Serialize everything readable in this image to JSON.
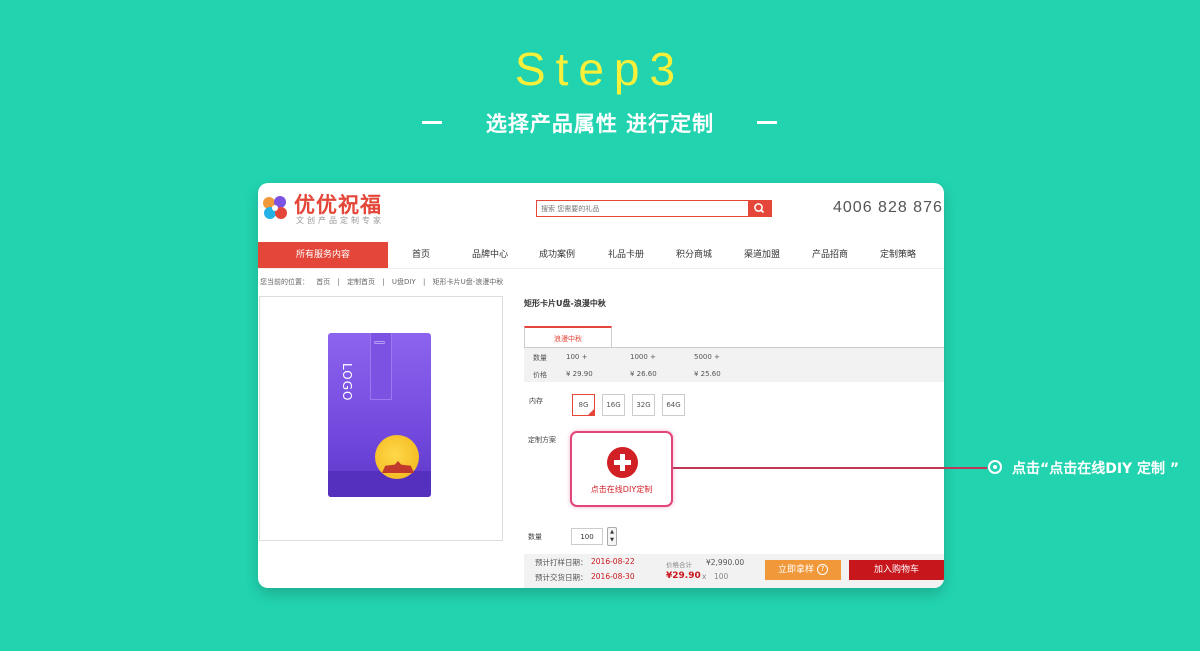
{
  "heading": {
    "step": "Step3",
    "subtitle": "选择产品属性 进行定制"
  },
  "site": {
    "logo_text": "优优祝福",
    "logo_sub": "文创产品定制专家",
    "search_placeholder": "搜索 您需要的礼品",
    "phone": "4006 828 876"
  },
  "nav": {
    "all": "所有服务内容",
    "items": [
      "首页",
      "品牌中心",
      "成功案例",
      "礼品卡册",
      "积分商城",
      "渠道加盟",
      "产品招商",
      "定制策略"
    ]
  },
  "breadcrumb": [
    "您当前的位置：",
    "首页",
    "|",
    "定制首页",
    "|",
    "U盘DIY",
    "|",
    "矩形卡片U盘-浪漫中秋"
  ],
  "product": {
    "image_logo_text": "LOGO",
    "title": "矩形卡片U盘-浪漫中秋",
    "variant_tab": "浪漫中秋",
    "qty_label": "数量",
    "price_label": "价格",
    "tiers": [
      {
        "qty": "100 +",
        "price": "¥ 29.90"
      },
      {
        "qty": "1000 +",
        "price": "¥ 26.60"
      },
      {
        "qty": "5000 +",
        "price": "¥ 25.60"
      }
    ],
    "memory_label": "内存",
    "memory_options": [
      "8G",
      "16G",
      "32G",
      "64G"
    ],
    "memory_selected": "8G",
    "plan_label": "定制方案",
    "diy_label": "点击在线DIY定制",
    "quantity_label": "数量",
    "quantity_value": "100",
    "sample_date_label": "预计打样日期：",
    "sample_date": "2016-08-22",
    "delivery_date_label": "预计交货日期：",
    "delivery_date": "2016-08-30",
    "total_label": "价格合计",
    "total": "¥2,990.00",
    "unit_price": "¥29.90",
    "times": "x",
    "unit_qty": "100",
    "sample_button": "立即拿样",
    "cart_button": "加入购物车"
  },
  "callout": "点击“点击在线DIY 定制 ”",
  "colors": {
    "background": "#22d3b0",
    "accent": "#e4473a",
    "title": "#f7f03a",
    "cart": "#c8161d",
    "sample": "#f1993a"
  }
}
